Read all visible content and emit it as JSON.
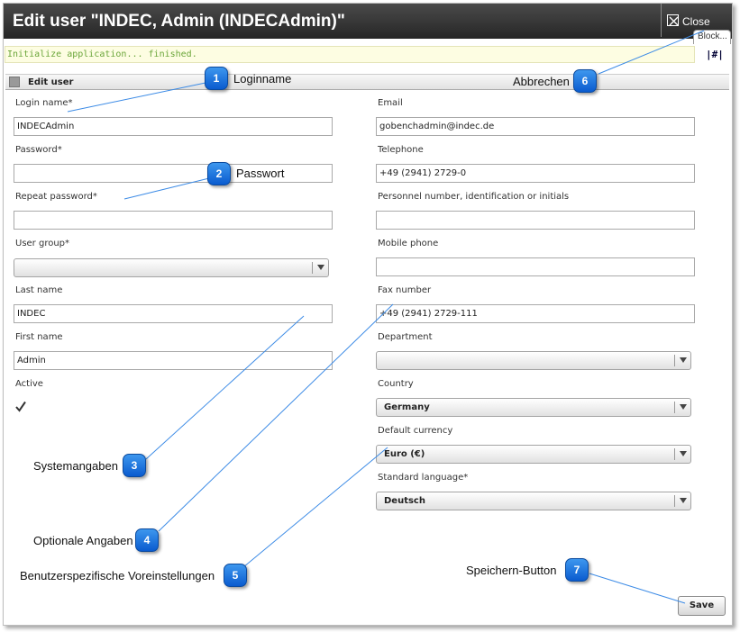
{
  "window": {
    "title": "Edit user \"INDEC, Admin (INDECAdmin)\"",
    "close_label": "Close",
    "block_tab": "Block..."
  },
  "status": {
    "message": "Initialize application... finished.",
    "hash_link": "|#|"
  },
  "section": {
    "title": "Edit user"
  },
  "left_fields": {
    "login_name": {
      "label": "Login name*",
      "value": "INDECAdmin"
    },
    "password": {
      "label": "Password*",
      "value": ""
    },
    "repeat_password": {
      "label": "Repeat password*",
      "value": ""
    },
    "user_group": {
      "label": "User group*",
      "value": ""
    },
    "last_name": {
      "label": "Last name",
      "value": "INDEC"
    },
    "first_name": {
      "label": "First name",
      "value": "Admin"
    },
    "active": {
      "label": "Active",
      "checked": true
    }
  },
  "right_fields": {
    "email": {
      "label": "Email",
      "value": "gobenchadmin@indec.de"
    },
    "telephone": {
      "label": "Telephone",
      "value": "+49 (2941) 2729-0"
    },
    "personnel_number": {
      "label": "Personnel number, identification or initials",
      "value": ""
    },
    "mobile_phone": {
      "label": "Mobile phone",
      "value": ""
    },
    "fax_number": {
      "label": "Fax number",
      "value": "+49 (2941) 2729-111"
    },
    "department": {
      "label": "Department",
      "value": ""
    },
    "country": {
      "label": "Country",
      "value": "Germany"
    },
    "default_currency": {
      "label": "Default currency",
      "value": "Euro (€)"
    },
    "standard_language": {
      "label": "Standard language*",
      "value": "Deutsch"
    }
  },
  "save_label": "Save",
  "callouts": [
    {
      "number": "1",
      "text": "Loginname"
    },
    {
      "number": "2",
      "text": "Passwort"
    },
    {
      "number": "3",
      "text": "Systemangaben"
    },
    {
      "number": "4",
      "text": "Optionale Angaben"
    },
    {
      "number": "5",
      "text": "Benutzerspezifische Voreinstellungen"
    },
    {
      "number": "6",
      "text": "Abbrechen"
    },
    {
      "number": "7",
      "text": "Speichern-Button"
    }
  ],
  "colors": {
    "title_bar": "#2f2f2f",
    "status_text": "#6ba63a",
    "status_bg": "#fdfde2",
    "marker": "#1a73e0",
    "callout_line": "#3c8be6"
  }
}
